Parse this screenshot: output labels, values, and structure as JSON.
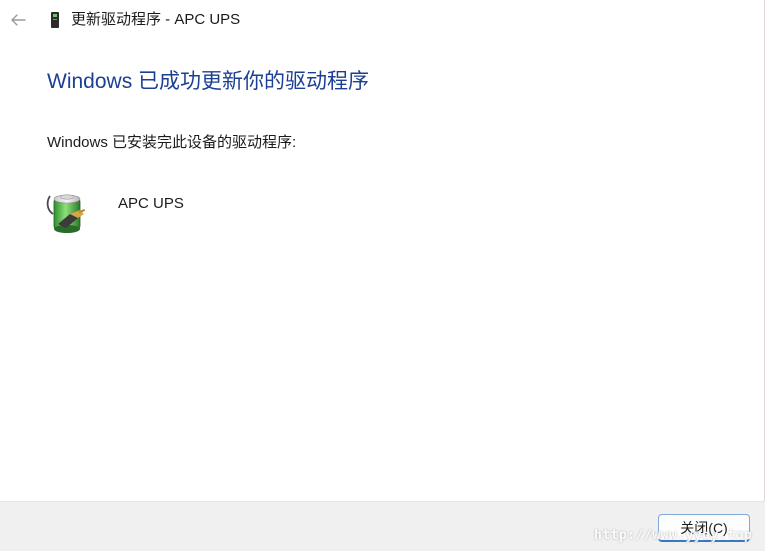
{
  "window": {
    "title": "更新驱动程序 - APC UPS"
  },
  "main": {
    "heading": "Windows 已成功更新你的驱动程序",
    "subtext": "Windows 已安装完此设备的驱动程序:",
    "device": {
      "name": "APC UPS",
      "icon": "battery-plug-icon"
    }
  },
  "footer": {
    "close_label": "关闭(C)",
    "watermark": "http://www.yydy.top"
  },
  "colors": {
    "heading": "#1c3f94",
    "footer_bg": "#f0f0f0",
    "button_border": "#3a78c2"
  }
}
